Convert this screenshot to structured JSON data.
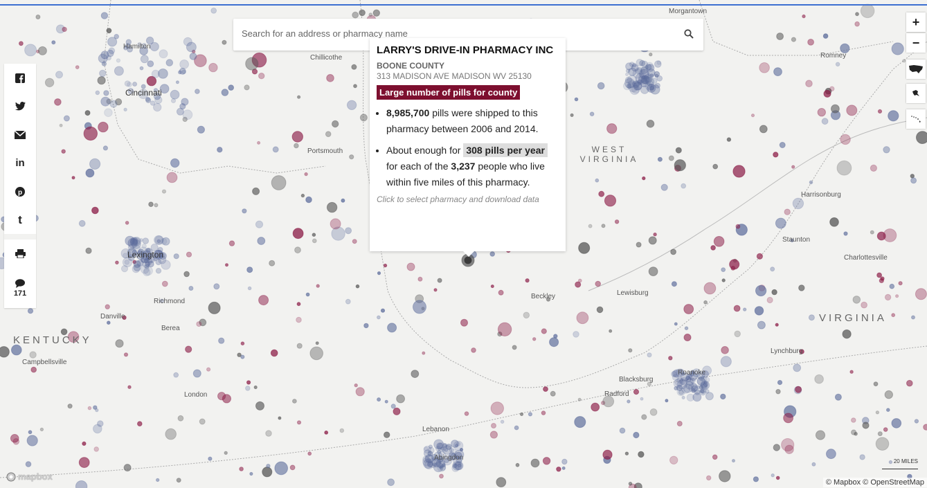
{
  "search": {
    "placeholder": "Search for an address or pharmacy name"
  },
  "places": [
    {
      "name": "Morgantown",
      "big": false
    },
    {
      "name": "Hamilton",
      "big": false
    },
    {
      "name": "Chillicothe",
      "big": false
    },
    {
      "name": "Cincinnati",
      "big": true
    },
    {
      "name": "Romney",
      "big": false
    },
    {
      "name": "Portsmouth",
      "big": false
    },
    {
      "name": "Harrisonburg",
      "big": false
    },
    {
      "name": "Staunton",
      "big": false
    },
    {
      "name": "Charlottesville",
      "big": false
    },
    {
      "name": "Lexington",
      "big": true
    },
    {
      "name": "Richmond",
      "big": false
    },
    {
      "name": "Danville",
      "big": false
    },
    {
      "name": "Berea",
      "big": false
    },
    {
      "name": "Beckley",
      "big": false
    },
    {
      "name": "Lewisburg",
      "big": false
    },
    {
      "name": "Lynchburg",
      "big": false
    },
    {
      "name": "Campbellsville",
      "big": false
    },
    {
      "name": "Blacksburg",
      "big": false
    },
    {
      "name": "Roanoke",
      "big": false
    },
    {
      "name": "Radford",
      "big": false
    },
    {
      "name": "London",
      "big": false
    },
    {
      "name": "Lebanon",
      "big": false
    },
    {
      "name": "Abingdon",
      "big": false
    }
  ],
  "states": [
    {
      "line1": "WEST",
      "line2": "VIRGINIA"
    },
    {
      "line1": "KENTUCKY"
    },
    {
      "line1": "VIRGINIA"
    }
  ],
  "share": {
    "comments_count": "171"
  },
  "popup": {
    "name": "LARRY'S DRIVE-IN PHARMACY INC",
    "county": "BOONE COUNTY",
    "address": "313 MADISON AVE MADISON WV 25130",
    "badge": "Large number of pills for county",
    "pills": "8,985,700",
    "b1_text": "pills were shipped to this pharmacy between 2006 and 2014.",
    "b2_pre": "About enough for",
    "pills_per_year": "308 pills per year",
    "b2_mid": "for each of the",
    "people": "3,237",
    "b2_post": "people who live within five miles of this pharmacy.",
    "hint": "Click to select pharmacy and download data"
  },
  "map_controls": {
    "zoom_in": "+",
    "zoom_out": "−"
  },
  "scale_label": "20 MILES",
  "attribution": "© Mapbox © OpenStreetMap",
  "logo_text": "mapbox",
  "colors": {
    "dot_red": "#8a1a45",
    "dot_blue": "#5a6a9a",
    "dot_gray": "#555555",
    "badge": "#7d0f2f"
  }
}
